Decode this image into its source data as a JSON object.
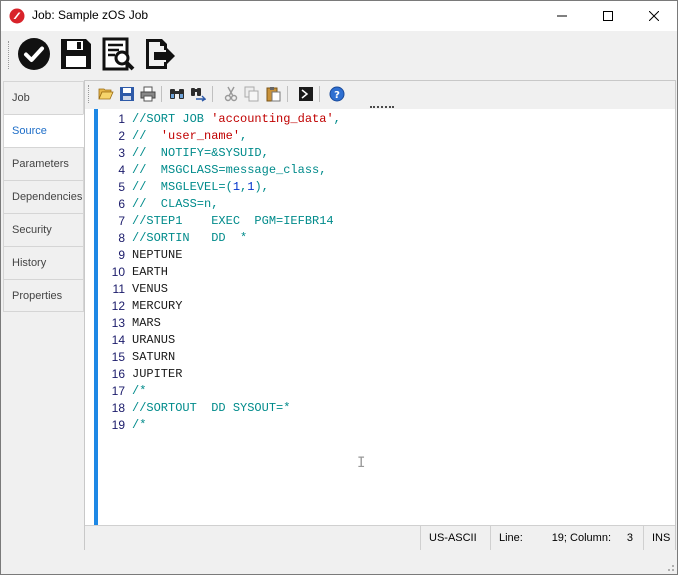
{
  "window": {
    "title": "Job: Sample zOS Job"
  },
  "title_controls": {
    "minimize": "minimize-icon",
    "maximize": "maximize-icon",
    "close": "close-icon"
  },
  "main_toolbar": {
    "buttons": [
      {
        "name": "submit-button",
        "icon": "check-circle-icon"
      },
      {
        "name": "save-button",
        "icon": "floppy-disk-icon"
      },
      {
        "name": "preview-button",
        "icon": "document-search-icon"
      },
      {
        "name": "export-button",
        "icon": "document-export-icon"
      }
    ]
  },
  "side_tabs": [
    {
      "label": "Job",
      "active": false
    },
    {
      "label": "Source",
      "active": true
    },
    {
      "label": "Parameters",
      "active": false
    },
    {
      "label": "Dependencies",
      "active": false
    },
    {
      "label": "Security",
      "active": false
    },
    {
      "label": "History",
      "active": false
    },
    {
      "label": "Properties",
      "active": false
    }
  ],
  "editor_toolbar": [
    "open-folder-icon",
    "save-icon",
    "print-icon",
    "find-icon",
    "find-replace-icon",
    "cut-icon",
    "copy-icon",
    "paste-icon",
    "terminal-icon",
    "help-icon"
  ],
  "code_lines": [
    {
      "n": "1",
      "segments": [
        {
          "t": "//SORT JOB ",
          "c": "comment"
        },
        {
          "t": "'accounting_data'",
          "c": "str"
        },
        {
          "t": ",",
          "c": "comment"
        }
      ]
    },
    {
      "n": "2",
      "segments": [
        {
          "t": "//  ",
          "c": "comment"
        },
        {
          "t": "'user_name'",
          "c": "str"
        },
        {
          "t": ",",
          "c": "comment"
        }
      ]
    },
    {
      "n": "3",
      "segments": [
        {
          "t": "//  NOTIFY=&SYSUID,",
          "c": "comment"
        }
      ]
    },
    {
      "n": "4",
      "segments": [
        {
          "t": "//  MSGCLASS=message_class,",
          "c": "comment"
        }
      ]
    },
    {
      "n": "5",
      "segments": [
        {
          "t": "//  MSGLEVEL=(",
          "c": "comment"
        },
        {
          "t": "1",
          "c": "num"
        },
        {
          "t": ",",
          "c": "comment"
        },
        {
          "t": "1",
          "c": "num"
        },
        {
          "t": "),",
          "c": "comment"
        }
      ]
    },
    {
      "n": "6",
      "segments": [
        {
          "t": "//  CLASS=n,",
          "c": "comment"
        }
      ]
    },
    {
      "n": "7",
      "segments": [
        {
          "t": "//STEP1    EXEC  PGM=IEFBR14",
          "c": "comment"
        }
      ]
    },
    {
      "n": "8",
      "segments": [
        {
          "t": "//SORTIN   DD  *",
          "c": "comment"
        }
      ]
    },
    {
      "n": "9",
      "segments": [
        {
          "t": "NEPTUNE",
          "c": "code"
        }
      ]
    },
    {
      "n": "10",
      "segments": [
        {
          "t": "EARTH",
          "c": "code"
        }
      ]
    },
    {
      "n": "11",
      "segments": [
        {
          "t": "VENUS",
          "c": "code"
        }
      ]
    },
    {
      "n": "12",
      "segments": [
        {
          "t": "MERCURY",
          "c": "code"
        }
      ]
    },
    {
      "n": "13",
      "segments": [
        {
          "t": "MARS",
          "c": "code"
        }
      ]
    },
    {
      "n": "14",
      "segments": [
        {
          "t": "URANUS",
          "c": "code"
        }
      ]
    },
    {
      "n": "15",
      "segments": [
        {
          "t": "SATURN",
          "c": "code"
        }
      ]
    },
    {
      "n": "16",
      "segments": [
        {
          "t": "JUPITER",
          "c": "code"
        }
      ]
    },
    {
      "n": "17",
      "segments": [
        {
          "t": "/*",
          "c": "comment"
        }
      ]
    },
    {
      "n": "18",
      "segments": [
        {
          "t": "//SORTOUT  DD SYSOUT=*",
          "c": "comment"
        }
      ]
    },
    {
      "n": "19",
      "segments": [
        {
          "t": "/*",
          "c": "comment"
        }
      ]
    }
  ],
  "status": {
    "encoding": "US-ASCII",
    "line_label": "Line:",
    "line_value": "19; Column:",
    "column_value": "3",
    "mode": "INS"
  },
  "colors": {
    "accent": "#1e88e5",
    "comment": "#008b8b",
    "string": "#c00000",
    "number": "#0033cc"
  }
}
